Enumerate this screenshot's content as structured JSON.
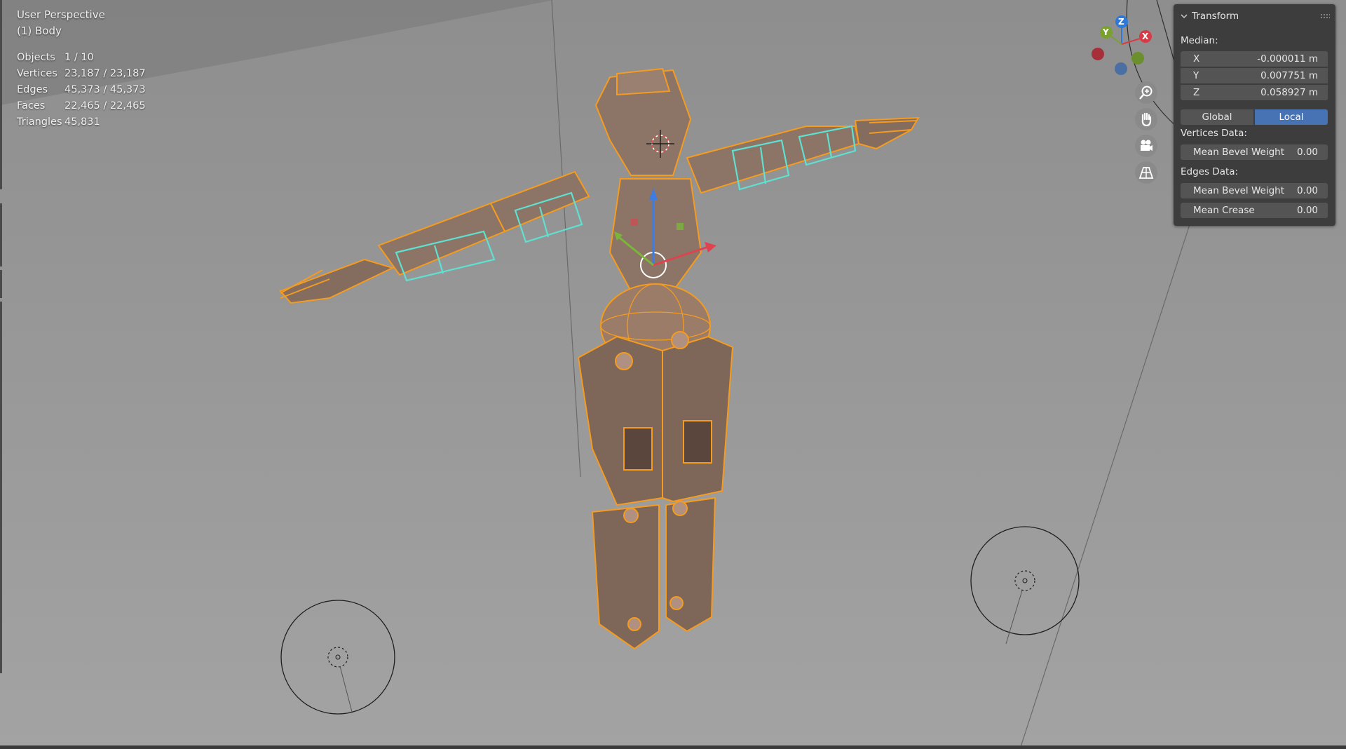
{
  "viewport": {
    "title": "User Perspective",
    "subtitle": "(1) Body"
  },
  "stats": [
    {
      "label": "Objects",
      "value": "1 / 10"
    },
    {
      "label": "Vertices",
      "value": "23,187 / 23,187"
    },
    {
      "label": "Edges",
      "value": "45,373 / 45,373"
    },
    {
      "label": "Faces",
      "value": "22,465 / 22,465"
    },
    {
      "label": "Triangles",
      "value": "45,831"
    }
  ],
  "gizmo": {
    "x_label": "X",
    "y_label": "Y",
    "z_label": "Z",
    "colors": {
      "x": "#d63c48",
      "y": "#7aa030",
      "z": "#2e78d8",
      "x_neg": "#a6303a",
      "y_neg": "#6b8f2a",
      "z_neg": "#4c6fa3"
    },
    "buttons": [
      "zoom-icon",
      "hand-pan-icon",
      "camera-icon",
      "grid-perspective-icon"
    ]
  },
  "transform_panel": {
    "title": "Transform",
    "median_label": "Median:",
    "median": [
      {
        "axis": "X",
        "value": "-0.000011 m"
      },
      {
        "axis": "Y",
        "value": "0.007751 m"
      },
      {
        "axis": "Z",
        "value": "0.058927 m"
      }
    ],
    "space_options": [
      "Global",
      "Local"
    ],
    "space_selected": "Local",
    "vertices_label": "Vertices Data:",
    "vertices_fields": [
      {
        "label": "Mean Bevel Weight",
        "value": "0.00"
      }
    ],
    "edges_label": "Edges Data:",
    "edges_fields": [
      {
        "label": "Mean Bevel Weight",
        "value": "0.00"
      },
      {
        "label": "Mean Crease",
        "value": "0.00"
      }
    ]
  },
  "theme": {
    "background": "#9c9c9c",
    "mesh_wire": "#f59b1f",
    "mesh_wire_selected": "#5fe0d0",
    "accent": "#4772b3",
    "panel": "#3d3d3d"
  }
}
